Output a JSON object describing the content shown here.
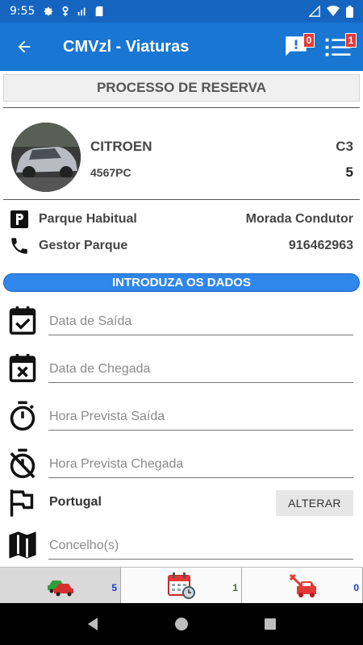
{
  "status": {
    "time": "9:55"
  },
  "appbar": {
    "title": "CMVzl - Viaturas",
    "messages_badge": "0",
    "list_badge": "1"
  },
  "section": {
    "title": "PROCESSO DE RESERVA"
  },
  "vehicle": {
    "brand": "CITROEN",
    "model": "C3",
    "plate": "4567PC",
    "seats": "5"
  },
  "info": {
    "parking_label": "Parque Habitual",
    "parking_value": "Morada Condutor",
    "manager_label": "Gestor Parque",
    "manager_value": "916462963"
  },
  "form": {
    "header": "INTRODUZA OS DADOS",
    "departure_date_placeholder": "Data de Saída",
    "arrival_date_placeholder": "Data de Chegada",
    "departure_time_placeholder": "Hora Prevista Saída",
    "arrival_time_placeholder": "Hora Prevista Chegada",
    "country": "Portugal",
    "change_button": "ALTERAR",
    "municipality_placeholder": "Concelho(s)"
  },
  "tabs": [
    {
      "icon": "cars-icon",
      "count": "5",
      "count_color": "#1a3fcf"
    },
    {
      "icon": "calendar-clock-icon",
      "count": "1",
      "count_color": "#2e7d32"
    },
    {
      "icon": "car-repair-icon",
      "count": "0",
      "count_color": "#1a3fcf"
    }
  ],
  "colors": {
    "statusbar": "#1565c0",
    "appbar": "#1976d2",
    "pill": "#2f86eb",
    "badge": "#e53935"
  }
}
